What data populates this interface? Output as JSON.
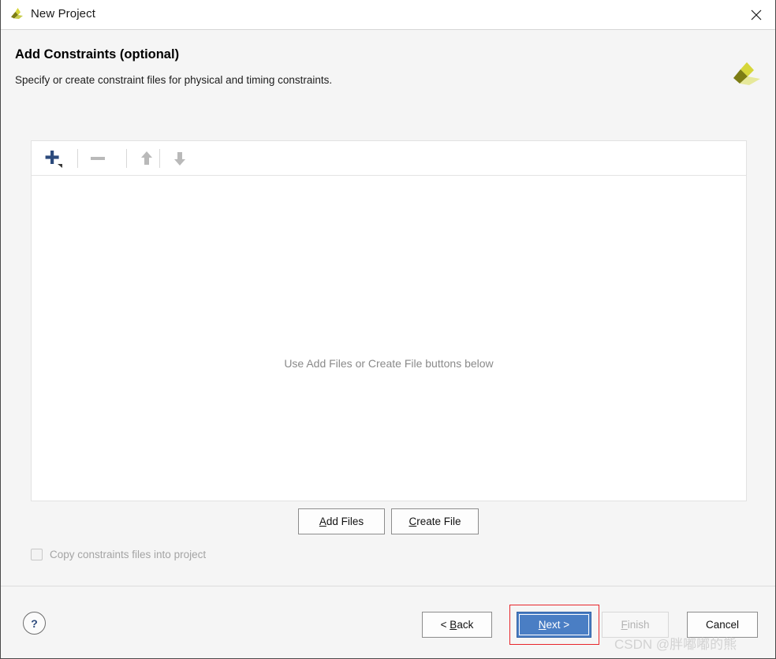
{
  "window": {
    "title": "New Project",
    "app_icon": "vivado-logo-icon",
    "close_icon": "close-icon"
  },
  "header": {
    "title": "Add Constraints (optional)",
    "subtitle": "Specify or create constraint files for physical and timing constraints.",
    "brand_icon": "xilinx-logo-icon"
  },
  "list_panel": {
    "toolbar": {
      "add_icon": "plus-icon",
      "add_dropdown_icon": "dropdown-triangle-icon",
      "remove_icon": "minus-icon",
      "move_up_icon": "arrow-up-icon",
      "move_down_icon": "arrow-down-icon"
    },
    "empty_hint": "Use Add Files or Create File buttons below",
    "rows": []
  },
  "file_actions": {
    "add_files": {
      "label": "Add Files",
      "mnemonic": "A"
    },
    "create_file": {
      "label": "Create File",
      "mnemonic": "C"
    }
  },
  "copy_option": {
    "label": "Copy constraints files into project",
    "checked": false,
    "enabled": false
  },
  "footer": {
    "help_label": "?",
    "back": {
      "label": "< Back",
      "mnemonic": "B",
      "enabled": true
    },
    "next": {
      "label": "Next >",
      "mnemonic": "N",
      "enabled": true,
      "focused": true,
      "highlighted": true
    },
    "finish": {
      "label": "Finish",
      "mnemonic": "F",
      "enabled": false
    },
    "cancel": {
      "label": "Cancel",
      "enabled": true
    }
  },
  "watermark": {
    "text": "CSDN @胖嘟嘟的熊"
  },
  "colors": {
    "page_background": "#f5f5f5",
    "panel_background": "#ffffff",
    "accent_blue": "#4a7ec4",
    "annotation_red": "#e8262b",
    "logo_olive": "#7d7d14",
    "logo_yellow": "#d6d63a",
    "logo_light": "#e6e89a",
    "disabled_gray": "#b2b2b2"
  }
}
